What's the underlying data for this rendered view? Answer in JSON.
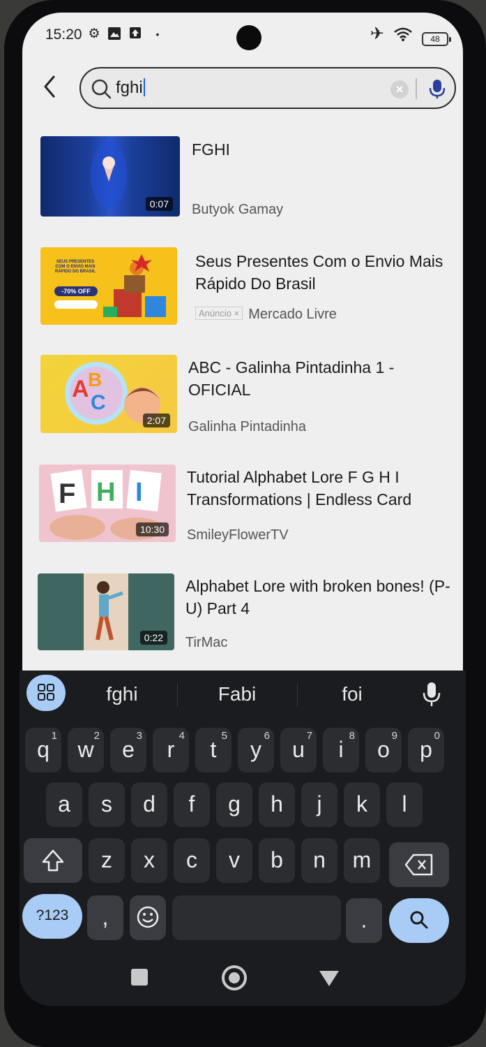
{
  "status_bar": {
    "time": "15:20",
    "battery": "48"
  },
  "search": {
    "query": "fghi",
    "clear_label": "×"
  },
  "results": [
    {
      "title": "FGHI",
      "channel": "Butyok Gamay",
      "duration": "0:07"
    },
    {
      "title": "Seus Presentes Com o Envio Mais Rápido Do Brasil",
      "channel": "Mercado Livre",
      "ad_badge": "Anúncio ×"
    },
    {
      "title": "ABC - Galinha Pintadinha 1 - OFICIAL",
      "channel": "Galinha Pintadinha",
      "duration": "2:07"
    },
    {
      "title": "Tutorial Alphabet Lore F G H I Transformations | Endless Card",
      "channel": "SmileyFlowerTV",
      "duration": "10:30"
    },
    {
      "title": "Alphabet Lore with broken bones! (P-U) Part 4",
      "channel": "TirMac",
      "duration": "0:22"
    }
  ],
  "ad_thumb_text": {
    "line1": "SEUS PRESENTES",
    "line2": "COM O ENVIO MAIS",
    "line3": "RÁPIDO DO BRASIL",
    "discount": "-70% OFF"
  },
  "keyboard": {
    "suggestions": [
      "fghi",
      "Fabi",
      "foi"
    ],
    "row1": [
      [
        "q",
        "1"
      ],
      [
        "w",
        "2"
      ],
      [
        "e",
        "3"
      ],
      [
        "r",
        "4"
      ],
      [
        "t",
        "5"
      ],
      [
        "y",
        "6"
      ],
      [
        "u",
        "7"
      ],
      [
        "i",
        "8"
      ],
      [
        "o",
        "9"
      ],
      [
        "p",
        "0"
      ]
    ],
    "row2": [
      "a",
      "s",
      "d",
      "f",
      "g",
      "h",
      "j",
      "k",
      "l"
    ],
    "row3": [
      "z",
      "x",
      "c",
      "v",
      "b",
      "n",
      "m"
    ],
    "symbols_label": "?123",
    "comma": ",",
    "period": "."
  },
  "colors": {
    "accent": "#a8ccf5",
    "keyboard_bg": "#1b1c1f",
    "screen_bg": "#efefef"
  }
}
